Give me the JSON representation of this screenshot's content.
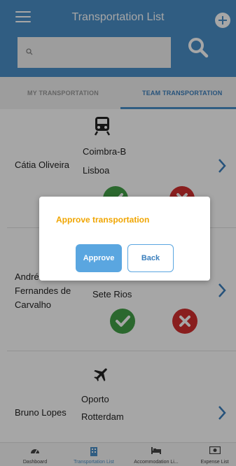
{
  "header": {
    "title": "Transportation List",
    "menu_icon": "hamburger-menu-icon",
    "add_icon": "plus-circle-icon",
    "search_icon": "magnifier-icon"
  },
  "search": {
    "placeholder": "",
    "value": ""
  },
  "tabs": [
    {
      "label": "MY TRANSPORTATION",
      "active": false
    },
    {
      "label": "TEAM TRANSPORTATION",
      "active": true
    }
  ],
  "list": [
    {
      "name": "Cátia Oliveira",
      "mode": "train",
      "from": "Coimbra-B",
      "to": "Lisboa"
    },
    {
      "name": "André\nFernandes de\nCarvalho",
      "mode": "",
      "from": "",
      "to": "Sete Rios"
    },
    {
      "name": "Bruno Lopes",
      "mode": "plane",
      "from": "Oporto",
      "to": "Rotterdam"
    }
  ],
  "dialog": {
    "title": "Approve transportation",
    "approve_label": "Approve",
    "back_label": "Back"
  },
  "bottom_nav": [
    {
      "label": "Dashboard",
      "icon": "dashboard-gauge-icon",
      "active": false
    },
    {
      "label": "Transportation List",
      "icon": "building-icon",
      "active": true
    },
    {
      "label": "Accommodation Li...",
      "icon": "bed-icon",
      "active": false
    },
    {
      "label": "Expense List",
      "icon": "money-bill-icon",
      "active": false
    }
  ],
  "colors": {
    "primary": "#4a90c8",
    "approve_green": "#43a047",
    "reject_red": "#d32f2f",
    "dialog_title": "#f0a500"
  }
}
